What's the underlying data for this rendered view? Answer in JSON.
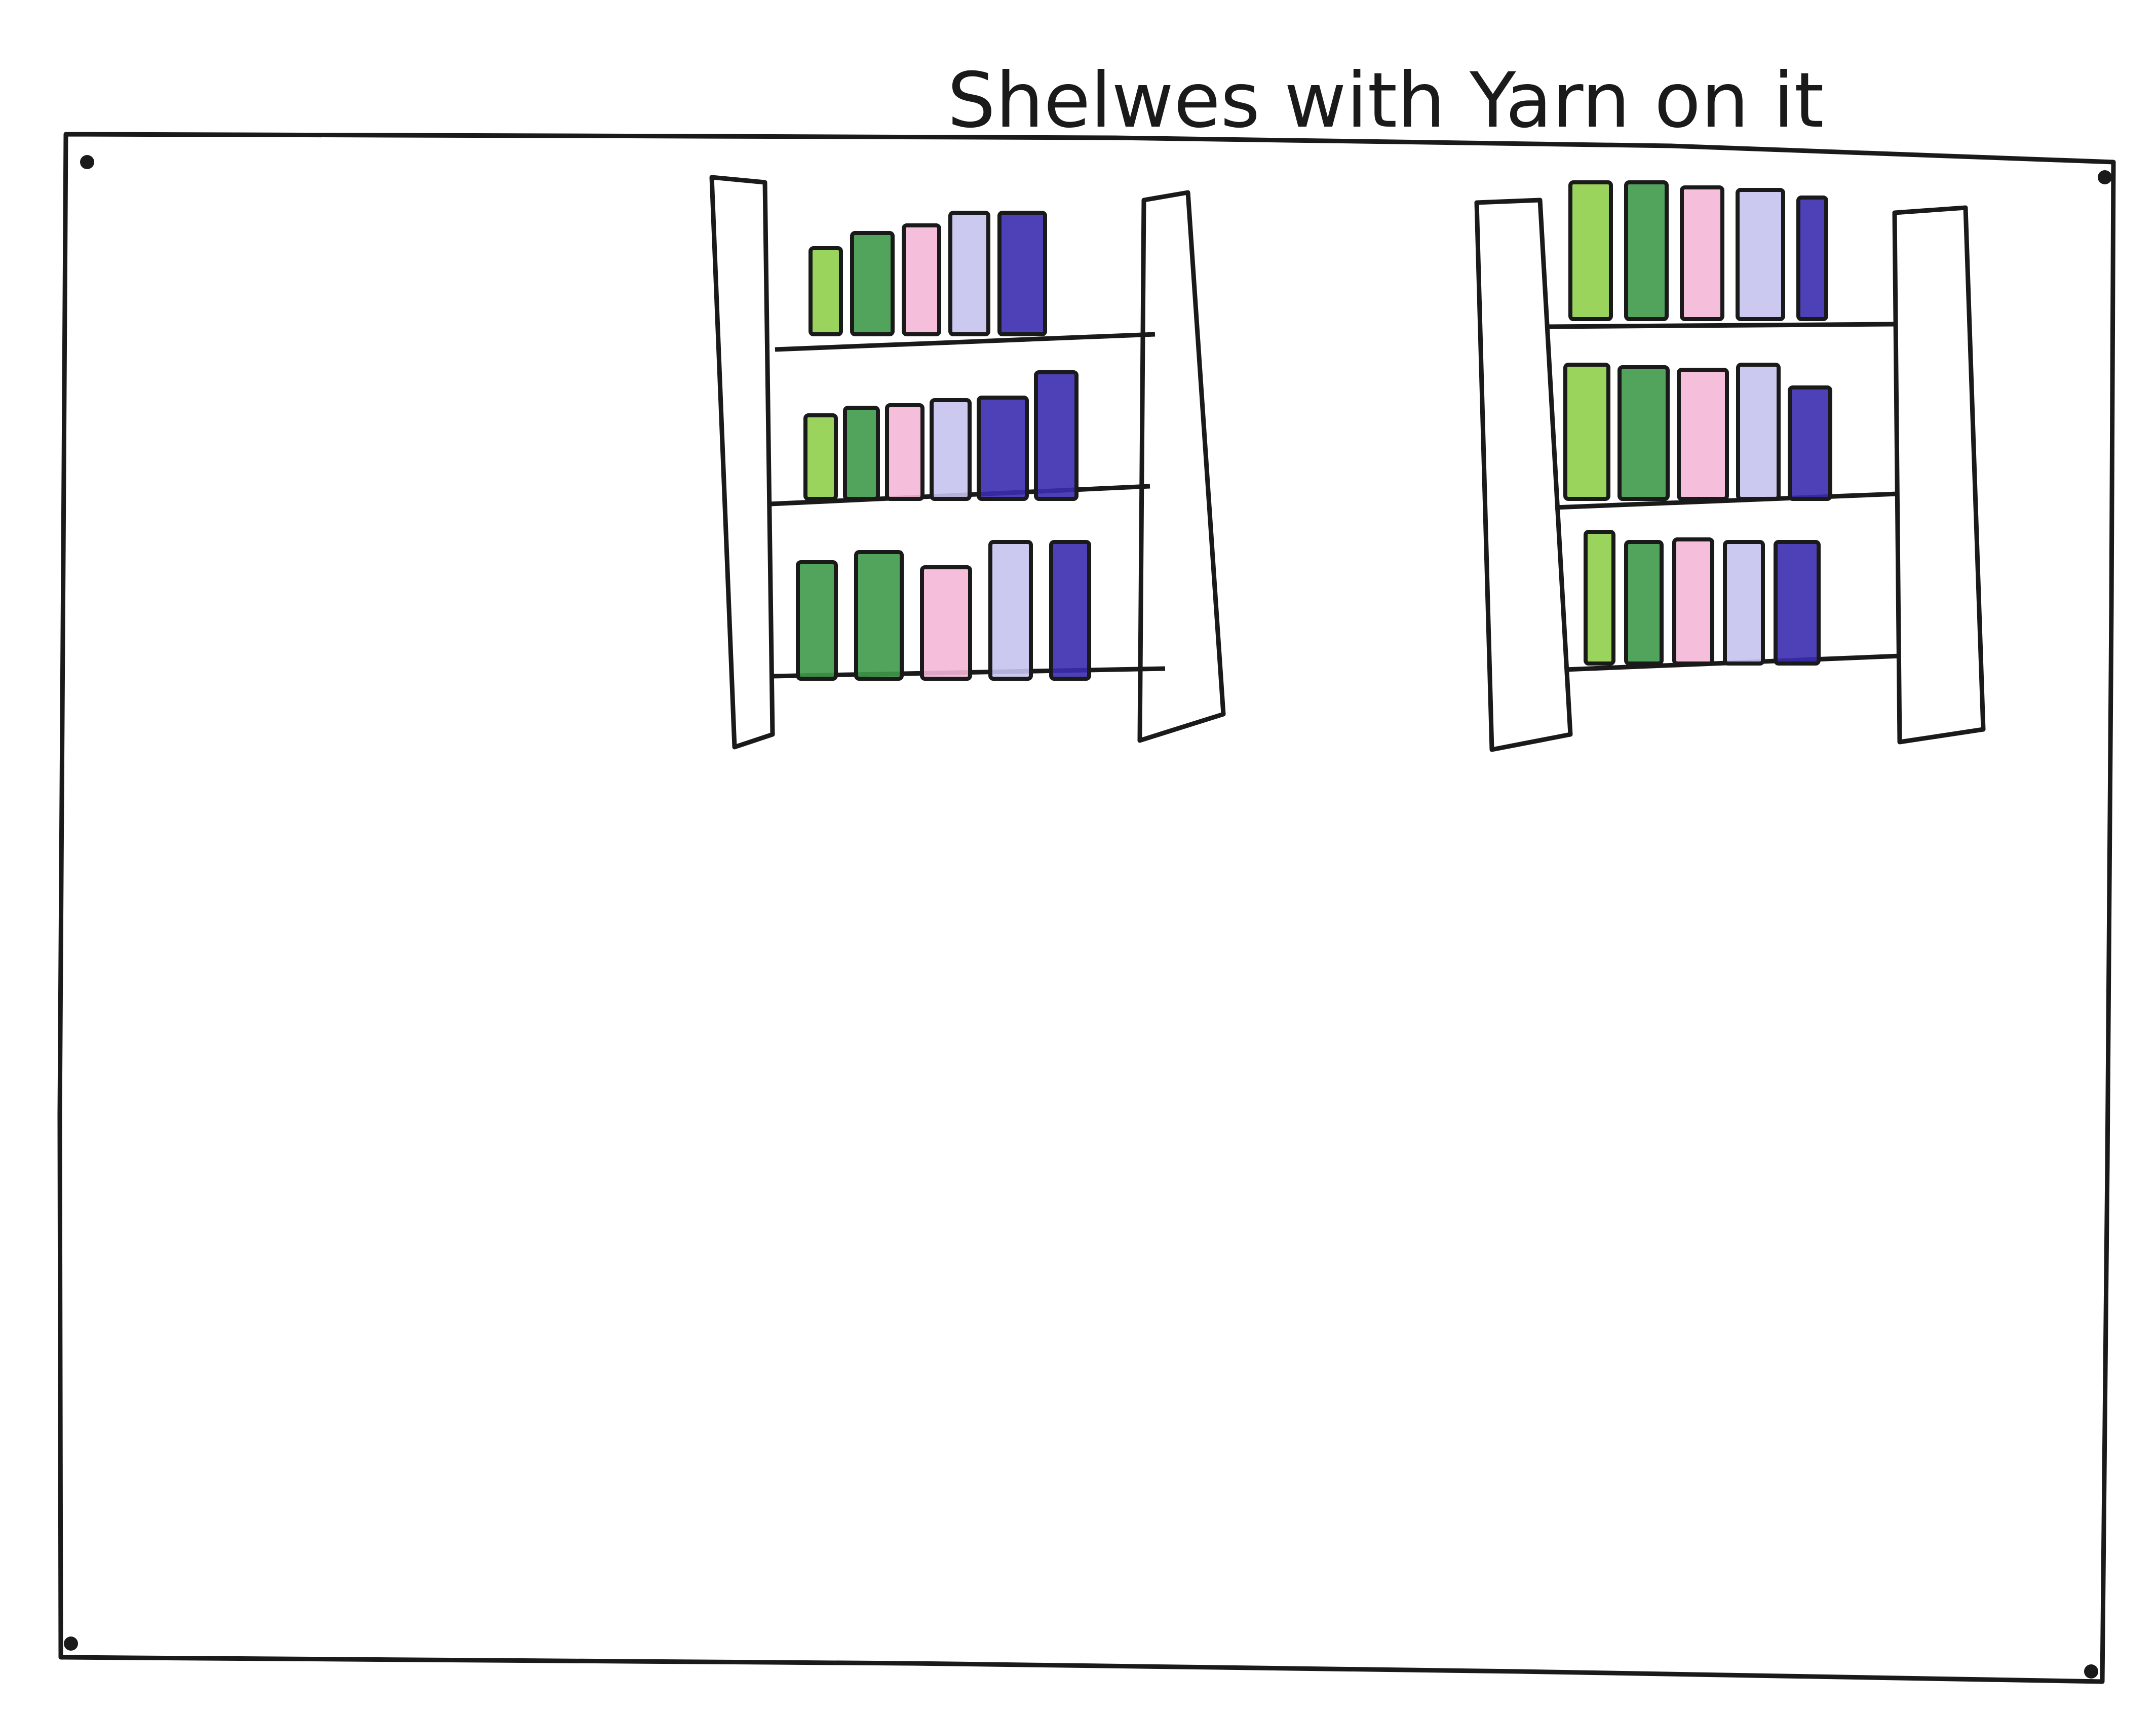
{
  "sketch": {
    "caption": "Shelwes with Yarn on it",
    "colors": {
      "paper": "#ffffff",
      "ink": "#1a1a1a",
      "light_green": "#8fcf4a",
      "green": "#3f9a4a",
      "pink": "#f4b8d8",
      "lavender": "#c6c3ee",
      "indigo": "#3b2cb0"
    },
    "shelf_units": [
      {
        "name": "left-shelf",
        "rows": [
          [
            "light_green",
            "green",
            "pink",
            "lavender",
            "indigo"
          ],
          [
            "light_green",
            "green",
            "pink",
            "lavender",
            "indigo",
            "indigo"
          ],
          [
            "green",
            "green",
            "pink",
            "lavender",
            "indigo"
          ]
        ]
      },
      {
        "name": "right-shelf",
        "rows": [
          [
            "light_green",
            "green",
            "pink",
            "lavender",
            "indigo"
          ],
          [
            "light_green",
            "green",
            "pink",
            "lavender",
            "indigo"
          ],
          [
            "light_green",
            "green",
            "pink",
            "lavender",
            "indigo"
          ]
        ]
      }
    ]
  }
}
